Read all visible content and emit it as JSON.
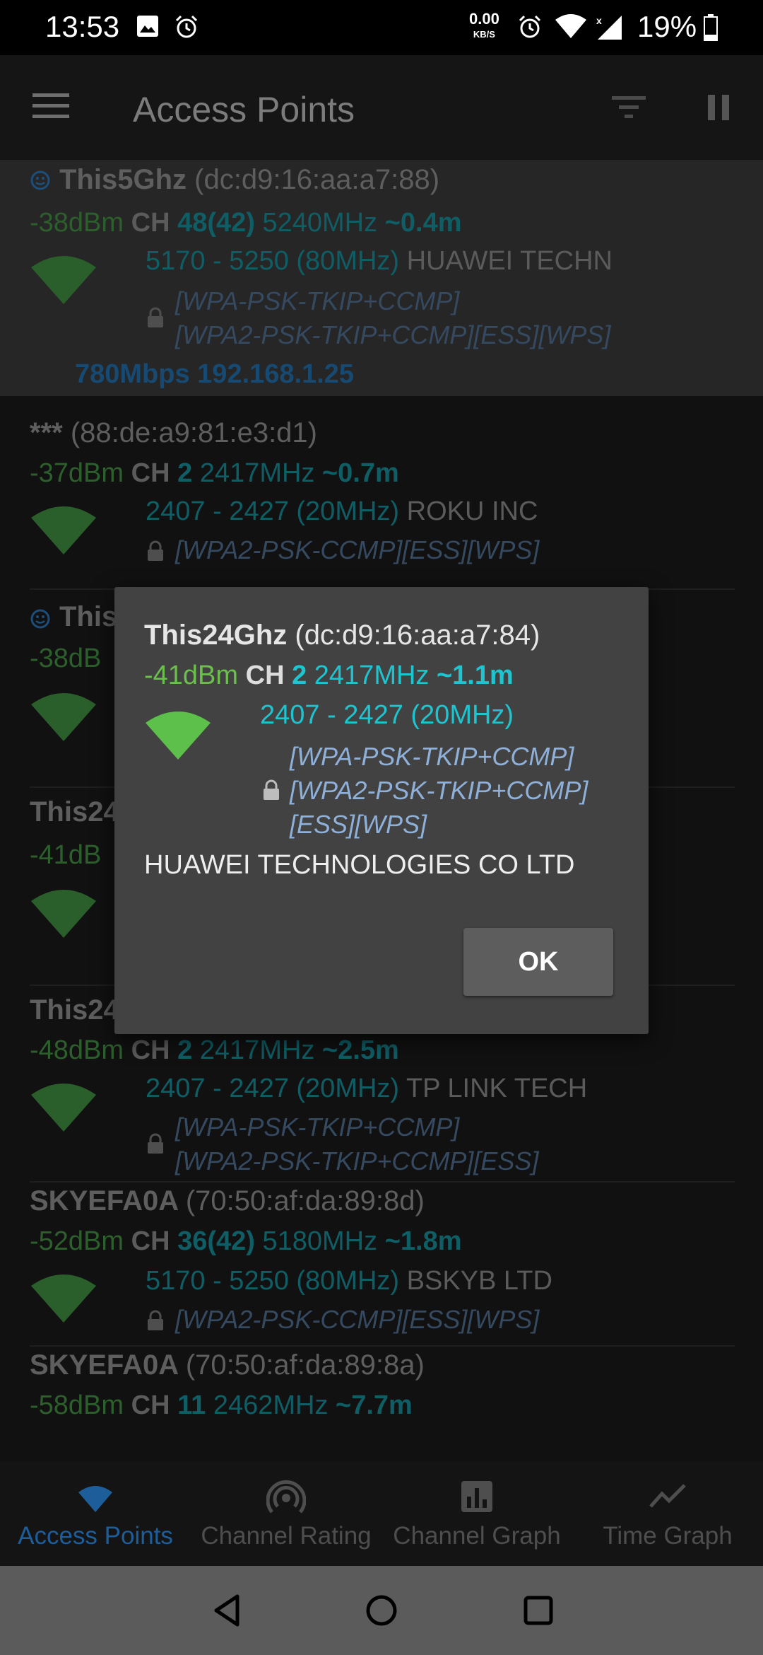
{
  "status_bar": {
    "time": "13:53",
    "net_speed_value": "0.00",
    "net_speed_unit": "KB/S",
    "battery": "19%"
  },
  "app_bar": {
    "title": "Access Points",
    "icons": [
      "menu-icon",
      "filter-icon",
      "pause-icon"
    ]
  },
  "access_points": [
    {
      "ssid": "This5Ghz",
      "mac": "(dc:d9:16:aa:a7:88)",
      "connected": true,
      "dbm": "-38dBm",
      "ch_label": "CH",
      "channel": "48(42)",
      "freq": "5240MHz",
      "dist": "~0.4m",
      "range": "5170 - 5250 (80MHz)",
      "vendor": "HUAWEI TECHN",
      "security": [
        "[WPA-PSK-TKIP+CCMP]",
        "[WPA2-PSK-TKIP+CCMP][ESS][WPS]"
      ],
      "link": "780Mbps 192.168.1.25"
    },
    {
      "ssid": "***",
      "mac": "(88:de:a9:81:e3:d1)",
      "dbm": "-37dBm",
      "ch_label": "CH",
      "channel": "2",
      "freq": "2417MHz",
      "dist": "~0.7m",
      "range": "2407 - 2427 (20MHz)",
      "vendor": "ROKU INC",
      "security": [
        "[WPA2-PSK-CCMP][ESS][WPS]"
      ]
    },
    {
      "ssid": "This",
      "dbm": "-38dB"
    },
    {
      "ssid": "This24",
      "dbm": "-41dB"
    },
    {
      "ssid": "This24",
      "dbm": "-48dBm",
      "ch_label": "CH",
      "channel": "2",
      "freq": "2417MHz",
      "dist": "~2.5m",
      "range": "2407 - 2427 (20MHz)",
      "vendor": "TP LINK TECH",
      "security": [
        "[WPA-PSK-TKIP+CCMP]",
        "[WPA2-PSK-TKIP+CCMP][ESS]"
      ]
    },
    {
      "ssid": "SKYEFA0A",
      "mac": "(70:50:af:da:89:8d)",
      "dbm": "-52dBm",
      "ch_label": "CH",
      "channel": "36(42)",
      "freq": "5180MHz",
      "dist": "~1.8m",
      "range": "5170 - 5250 (80MHz)",
      "vendor": "BSKYB LTD",
      "security": [
        "[WPA2-PSK-CCMP][ESS][WPS]"
      ]
    },
    {
      "ssid": "SKYEFA0A",
      "mac": "(70:50:af:da:89:8a)",
      "dbm": "-58dBm",
      "ch_label": "CH",
      "channel": "11",
      "freq": "2462MHz",
      "dist": "~7.7m"
    }
  ],
  "dialog": {
    "ssid": "This24Ghz",
    "mac": "(dc:d9:16:aa:a7:84)",
    "dbm": "-41dBm",
    "ch_label": "CH",
    "channel": "2",
    "freq": "2417MHz",
    "dist": "~1.1m",
    "range": "2407 - 2427 (20MHz)",
    "security": [
      "[WPA-PSK-TKIP+CCMP]",
      "[WPA2-PSK-TKIP+CCMP]",
      "[ESS][WPS]"
    ],
    "vendor": "HUAWEI TECHNOLOGIES CO LTD",
    "ok_label": "OK"
  },
  "bottom_nav": [
    {
      "label": "Access Points",
      "icon": "wifi-icon",
      "active": true
    },
    {
      "label": "Channel Rating",
      "icon": "antenna-icon",
      "active": false
    },
    {
      "label": "Channel Graph",
      "icon": "bar-chart-icon",
      "active": false
    },
    {
      "label": "Time Graph",
      "icon": "line-chart-icon",
      "active": false
    }
  ],
  "colors": {
    "accent_blue": "#1d5e9a",
    "signal_green": "#6cbf4f",
    "cyan": "#1ec4cf"
  }
}
